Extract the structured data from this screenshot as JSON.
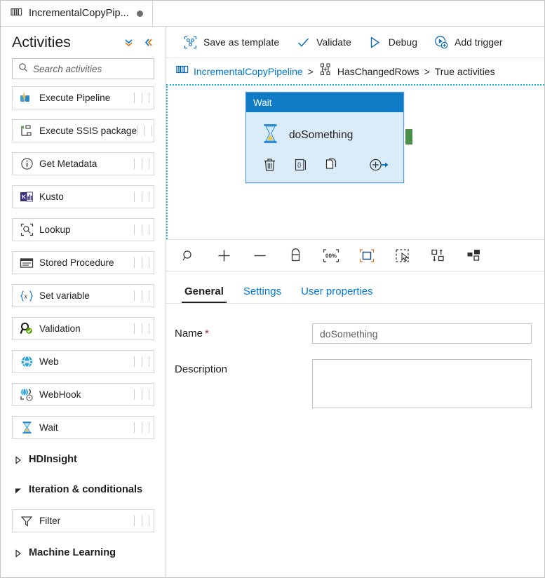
{
  "tab": {
    "icon": "pipeline-icon",
    "title": "IncrementalCopyPip...",
    "dirty_indicator": "unsaved-changes-dot"
  },
  "sidebar": {
    "title": "Activities",
    "collapse_all_icon": "double-chevron-down-icon",
    "collapse_pane_icon": "double-chevron-left-icon",
    "search": {
      "placeholder": "Search activities",
      "value": "",
      "icon": "search-icon"
    },
    "items": [
      {
        "type": "activity",
        "label": "Execute Pipeline",
        "icon": "execute-pipeline-icon"
      },
      {
        "type": "activity",
        "label": "Execute SSIS package",
        "icon": "execute-ssis-package-icon"
      },
      {
        "type": "activity",
        "label": "Get Metadata",
        "icon": "get-metadata-icon"
      },
      {
        "type": "activity",
        "label": "Kusto",
        "icon": "kusto-icon"
      },
      {
        "type": "activity",
        "label": "Lookup",
        "icon": "lookup-icon"
      },
      {
        "type": "activity",
        "label": "Stored Procedure",
        "icon": "stored-procedure-icon"
      },
      {
        "type": "activity",
        "label": "Set variable",
        "icon": "set-variable-icon"
      },
      {
        "type": "activity",
        "label": "Validation",
        "icon": "validation-icon"
      },
      {
        "type": "activity",
        "label": "Web",
        "icon": "web-icon"
      },
      {
        "type": "activity",
        "label": "WebHook",
        "icon": "webhook-icon"
      },
      {
        "type": "activity",
        "label": "Wait",
        "icon": "wait-hourglass-icon"
      },
      {
        "type": "group",
        "label": "HDInsight",
        "expanded": false
      },
      {
        "type": "group",
        "label": "Iteration & conditionals",
        "expanded": true
      },
      {
        "type": "activity",
        "label": "Filter",
        "icon": "filter-icon"
      },
      {
        "type": "group",
        "label": "Machine Learning",
        "expanded": false
      }
    ]
  },
  "commandbar": {
    "buttons": [
      {
        "label": "Save as template",
        "icon": "save-as-template-icon"
      },
      {
        "label": "Validate",
        "icon": "checkmark-icon"
      },
      {
        "label": "Debug",
        "icon": "play-triangle-icon"
      },
      {
        "label": "Add trigger",
        "icon": "add-trigger-icon"
      }
    ]
  },
  "breadcrumb": {
    "pipeline_icon": "pipeline-icon",
    "pipeline": "IncrementalCopyPipeline",
    "separator1": ">",
    "condition_icon": "if-condition-icon",
    "condition": "HasChangedRows",
    "separator2": ">",
    "current": "True activities"
  },
  "canvas": {
    "node": {
      "type_label": "Wait",
      "name": "doSomething",
      "type_icon": "wait-hourglass-icon",
      "header_color": "#0f7bc4",
      "body_color": "#d9ecf8",
      "border_color": "#5b9bd5",
      "output_port_color": "#4a8f4a",
      "actions": [
        {
          "name": "delete",
          "icon": "trash-icon"
        },
        {
          "name": "code",
          "icon": "code-braces-icon"
        },
        {
          "name": "clone",
          "icon": "copy-pages-icon"
        },
        {
          "name": "add-next-activity",
          "icon": "add-arrow-icon"
        }
      ]
    },
    "toolbar": [
      {
        "name": "zoom-to-fit",
        "icon": "magnifier-icon"
      },
      {
        "name": "zoom-in",
        "icon": "plus-icon"
      },
      {
        "name": "zoom-out",
        "icon": "minus-icon"
      },
      {
        "name": "lock-canvas",
        "icon": "lock-icon"
      },
      {
        "name": "zoom-100-percent",
        "icon": "zoom-100-icon",
        "text": "00%"
      },
      {
        "name": "fit-to-screen",
        "icon": "fit-to-screen-icon"
      },
      {
        "name": "marquee-select",
        "icon": "marquee-select-icon"
      },
      {
        "name": "auto-align",
        "icon": "auto-align-icon"
      },
      {
        "name": "toggle-layout",
        "icon": "layout-toggle-icon"
      }
    ]
  },
  "properties": {
    "tabs": [
      {
        "label": "General",
        "active": true
      },
      {
        "label": "Settings",
        "active": false
      },
      {
        "label": "User properties",
        "active": false
      }
    ],
    "fields": {
      "name_label": "Name",
      "name_required_marker": "*",
      "name_value": "doSomething",
      "description_label": "Description",
      "description_value": ""
    }
  }
}
